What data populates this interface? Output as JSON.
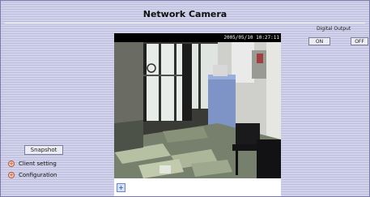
{
  "page": {
    "title": "Network Camera"
  },
  "viewer": {
    "timestamp": "2005/05/10 10:27:11",
    "ptz_glyph": "+"
  },
  "digital_output": {
    "label": "Digital Output",
    "on_label": "ON",
    "off_label": "OFF"
  },
  "controls": {
    "snapshot_label": "Snapshot"
  },
  "menu": [
    {
      "label": "Client setting",
      "bullet": "+"
    },
    {
      "label": "Configuration",
      "bullet": "+"
    }
  ],
  "colors": {
    "background": "#c9c9e5",
    "accent": "#b03a18"
  }
}
